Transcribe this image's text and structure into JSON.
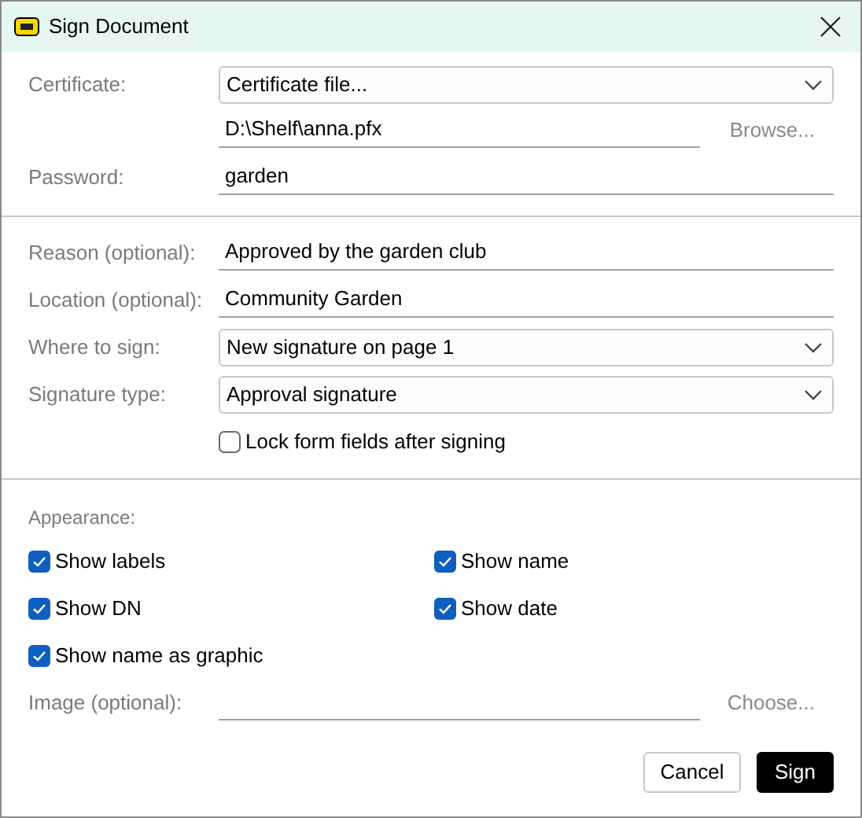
{
  "window": {
    "title": "Sign Document"
  },
  "certificate": {
    "label": "Certificate:",
    "value": "Certificate file...",
    "path": "D:\\Shelf\\anna.pfx",
    "browse": {
      "label": "Browse...",
      "disabled": true
    }
  },
  "password": {
    "label": "Password:",
    "value": "garden"
  },
  "fields": [
    {
      "kind": "text",
      "label": "Reason (optional):",
      "value": "Approved by the garden club"
    },
    {
      "kind": "text",
      "label": "Location (optional):",
      "value": "Community Garden"
    },
    {
      "kind": "select",
      "label": "Where to sign:",
      "value": "New signature on page 1"
    },
    {
      "kind": "select",
      "label": "Signature type:",
      "value": "Approval signature"
    }
  ],
  "lock": {
    "label": "Lock form fields after signing",
    "checked": false
  },
  "appearance": {
    "label": "Appearance:",
    "options": [
      {
        "label": "Show labels",
        "checked": true
      },
      {
        "label": "Show name",
        "checked": true
      },
      {
        "label": "Show DN",
        "checked": true
      },
      {
        "label": "Show date",
        "checked": true
      },
      {
        "label": "Show name as graphic",
        "checked": true
      }
    ],
    "image": {
      "label": "Image (optional):",
      "choose": {
        "label": "Choose...",
        "disabled": true
      }
    }
  },
  "buttons": [
    {
      "label": "Cancel",
      "kind": "secondary"
    },
    {
      "label": "Sign",
      "kind": "primary"
    }
  ]
}
